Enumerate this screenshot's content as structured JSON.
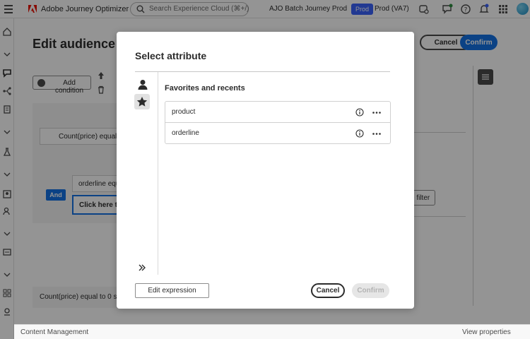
{
  "shell": {
    "app_title": "Adobe Journey Optimizer",
    "search_placeholder": "Search Experience Cloud (⌘+/)",
    "org_name": "AJO Batch Journey Prod",
    "sandbox_badge": "Prod",
    "sandbox_name": "Prod (VA7)",
    "icons": [
      "menu-icon",
      "adobe-logo-icon",
      "search-icon",
      "apps-icon",
      "feedback-icon",
      "help-icon",
      "notifications-icon",
      "grid-icon",
      "avatar"
    ]
  },
  "left_rail": {
    "icons": [
      "home-icon",
      "chevron-icon",
      "campaigns-icon",
      "journeys-icon",
      "content-icon",
      "chevron-icon",
      "flask-icon",
      "chevron-icon",
      "audience-icon",
      "profile-icon",
      "chevron-icon",
      "channels-icon",
      "chevron-icon",
      "schema-icon",
      "admin-icon"
    ]
  },
  "bottom_bar": {
    "left_label": "Content Management",
    "right_label": "View properties"
  },
  "edit_audience": {
    "title": "Edit audience",
    "cancel_label": "Cancel",
    "confirm_label": "Confirm",
    "add_condition_label": "Add condition",
    "count_condition": "Count(price) equal to 0",
    "and_label": "And",
    "orderline_condition": "orderline equal",
    "click_here": "Click here to c",
    "filter_label": "e filter",
    "summary": "Count(price) equal to 0 such"
  },
  "modal": {
    "title": "Select attribute",
    "section_title": "Favorites and recents",
    "attributes": [
      {
        "name": "product"
      },
      {
        "name": "orderline"
      }
    ],
    "edit_expression_label": "Edit expression",
    "cancel_label": "Cancel",
    "confirm_label": "Confirm",
    "confirm_disabled": true
  }
}
